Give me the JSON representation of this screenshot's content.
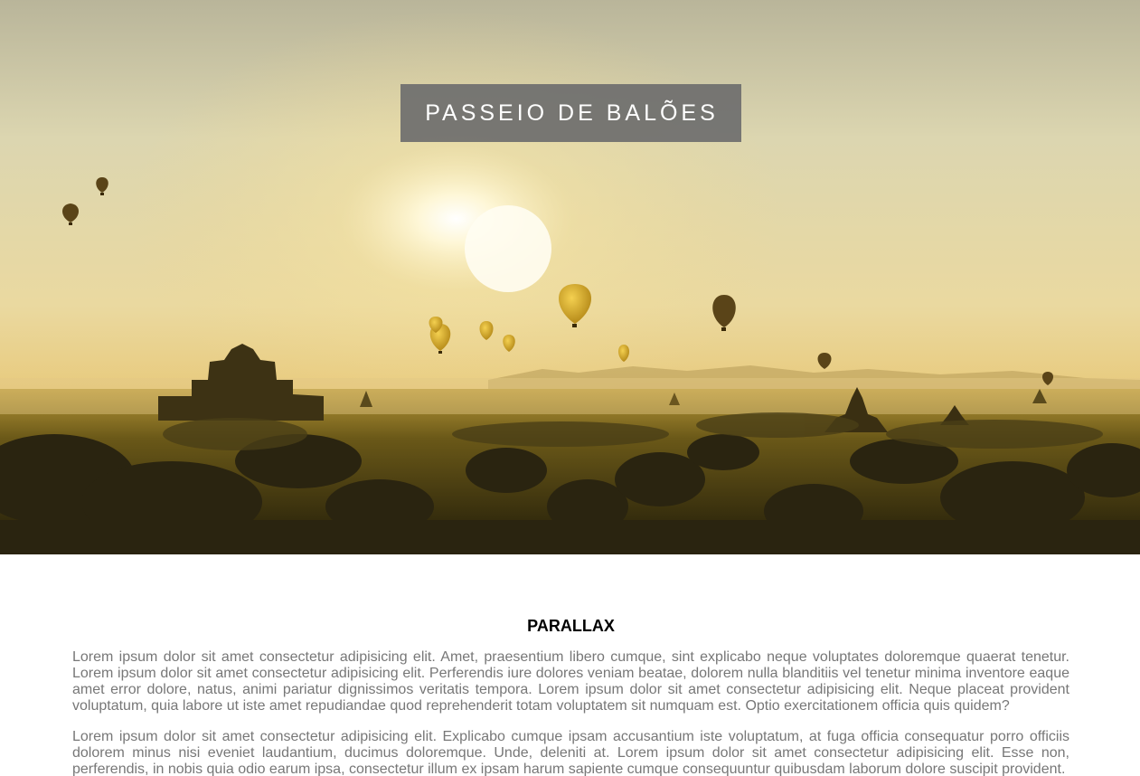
{
  "hero": {
    "title": "PASSEIO DE BALÕES",
    "image_description_icon": "balloons-landscape-image"
  },
  "section": {
    "title": "PARALLAX",
    "paragraphs": [
      "Lorem ipsum dolor sit amet consectetur adipisicing elit. Amet, praesentium libero cumque, sint explicabo neque voluptates doloremque quaerat tenetur. Lorem ipsum dolor sit amet consectetur adipisicing elit. Perferendis iure dolores veniam beatae, dolorem nulla blanditiis vel tenetur minima inventore eaque amet error dolore, natus, animi pariatur dignissimos veritatis tempora. Lorem ipsum dolor sit amet consectetur adipisicing elit. Neque placeat provident voluptatum, quia labore ut iste amet repudiandae quod reprehenderit totam voluptatem sit numquam est. Optio exercitationem officia quis quidem?",
      "Lorem ipsum dolor sit amet consectetur adipisicing elit. Explicabo cumque ipsam accusantium iste voluptatum, at fuga officia consequatur porro officiis dolorem minus nisi eveniet laudantium, ducimus doloremque. Unde, deleniti at. Lorem ipsum dolor sit amet consectetur adipisicing elit. Esse non, perferendis, in nobis quia odio earum ipsa, consectetur illum ex ipsam harum sapiente cumque consequuntur quibusdam laborum dolore suscipit provident."
    ]
  }
}
